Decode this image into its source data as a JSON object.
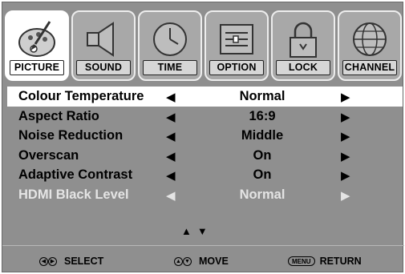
{
  "tabs": [
    {
      "label": "PICTURE",
      "icon": "palette-icon",
      "active": true
    },
    {
      "label": "SOUND",
      "icon": "speaker-icon",
      "active": false
    },
    {
      "label": "TIME",
      "icon": "clock-icon",
      "active": false
    },
    {
      "label": "OPTION",
      "icon": "option-panel-icon",
      "active": false
    },
    {
      "label": "LOCK",
      "icon": "padlock-icon",
      "active": false
    },
    {
      "label": "CHANNEL",
      "icon": "globe-icon",
      "active": false
    }
  ],
  "menu": {
    "items": [
      {
        "label": "Colour Temperature",
        "value": "Normal",
        "selected": true,
        "enabled": true
      },
      {
        "label": "Aspect Ratio",
        "value": "16:9",
        "selected": false,
        "enabled": true
      },
      {
        "label": "Noise Reduction",
        "value": "Middle",
        "selected": false,
        "enabled": true
      },
      {
        "label": "Overscan",
        "value": "On",
        "selected": false,
        "enabled": true
      },
      {
        "label": "Adaptive Contrast",
        "value": "On",
        "selected": false,
        "enabled": true
      },
      {
        "label": "HDMI Black Level",
        "value": "Normal",
        "selected": false,
        "enabled": false
      }
    ],
    "arrow_left": "◀",
    "arrow_right": "▶",
    "scroll_hint": "▲▼"
  },
  "footer": {
    "select_label": "SELECT",
    "move_label": "MOVE",
    "menu_key": "MENU",
    "return_label": "RETURN"
  },
  "colors": {
    "background": "#8f8f8f",
    "tab_inactive": "#a8a8a8",
    "highlight": "#ffffff",
    "disabled_text": "#e4e4e4"
  }
}
